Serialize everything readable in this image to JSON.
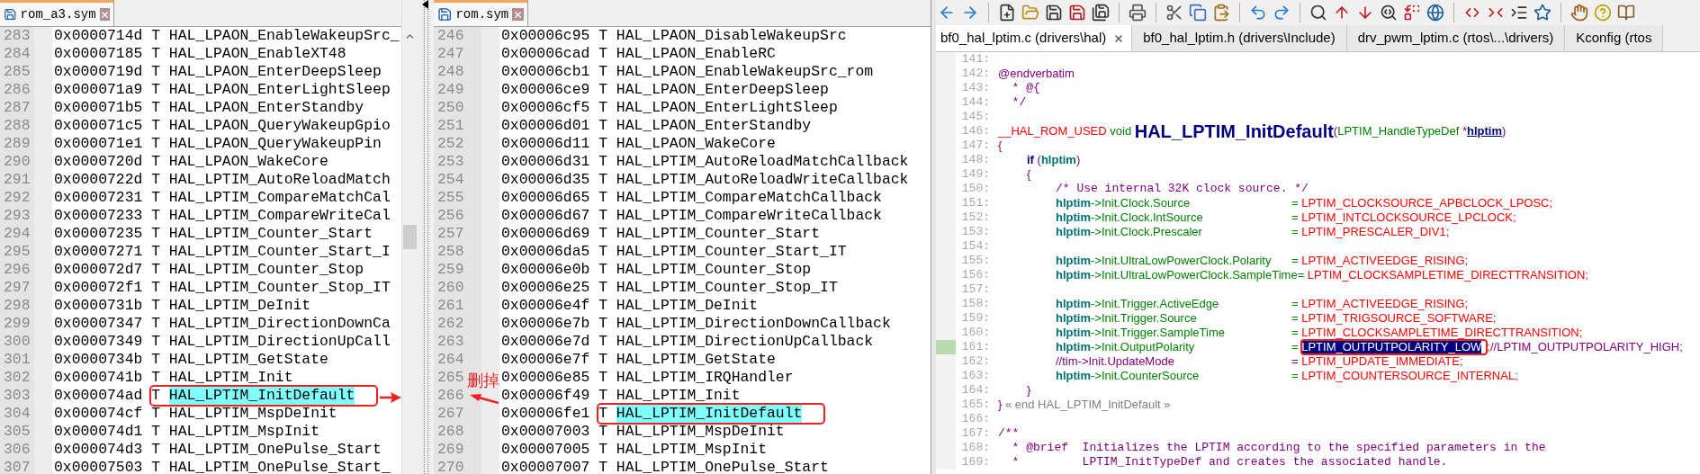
{
  "left_editor": {
    "tab": {
      "label": "rom_a3.sym",
      "selected": true
    },
    "rows": [
      {
        "line": "283",
        "address": "0x0000714d",
        "type": "T",
        "symbol": "HAL_LPAON_EnableWakeupSrc_",
        "highlighted": false
      },
      {
        "line": "284",
        "address": "0x00007185",
        "type": "T",
        "symbol": "HAL_LPAON_EnableXT48",
        "highlighted": false
      },
      {
        "line": "285",
        "address": "0x0000719d",
        "type": "T",
        "symbol": "HAL_LPAON_EnterDeepSleep",
        "highlighted": false
      },
      {
        "line": "286",
        "address": "0x000071a9",
        "type": "T",
        "symbol": "HAL_LPAON_EnterLightSleep",
        "highlighted": false
      },
      {
        "line": "287",
        "address": "0x000071b5",
        "type": "T",
        "symbol": "HAL_LPAON_EnterStandby",
        "highlighted": false
      },
      {
        "line": "288",
        "address": "0x000071c5",
        "type": "T",
        "symbol": "HAL_LPAON_QueryWakeupGpio",
        "highlighted": false
      },
      {
        "line": "289",
        "address": "0x000071e1",
        "type": "T",
        "symbol": "HAL_LPAON_QueryWakeupPin",
        "highlighted": false
      },
      {
        "line": "290",
        "address": "0x0000720d",
        "type": "T",
        "symbol": "HAL_LPAON_WakeCore",
        "highlighted": false
      },
      {
        "line": "291",
        "address": "0x0000722d",
        "type": "T",
        "symbol": "HAL_LPTIM_AutoReloadMatch",
        "highlighted": false
      },
      {
        "line": "292",
        "address": "0x00007231",
        "type": "T",
        "symbol": "HAL_LPTIM_CompareMatchCal",
        "highlighted": false
      },
      {
        "line": "293",
        "address": "0x00007233",
        "type": "T",
        "symbol": "HAL_LPTIM_CompareWriteCal",
        "highlighted": false
      },
      {
        "line": "294",
        "address": "0x00007235",
        "type": "T",
        "symbol": "HAL_LPTIM_Counter_Start",
        "highlighted": false
      },
      {
        "line": "295",
        "address": "0x00007271",
        "type": "T",
        "symbol": "HAL_LPTIM_Counter_Start_I",
        "highlighted": false
      },
      {
        "line": "296",
        "address": "0x000072d7",
        "type": "T",
        "symbol": "HAL_LPTIM_Counter_Stop",
        "highlighted": false
      },
      {
        "line": "297",
        "address": "0x000072f1",
        "type": "T",
        "symbol": "HAL_LPTIM_Counter_Stop_IT",
        "highlighted": false
      },
      {
        "line": "298",
        "address": "0x0000731b",
        "type": "T",
        "symbol": "HAL_LPTIM_DeInit",
        "highlighted": false
      },
      {
        "line": "299",
        "address": "0x00007347",
        "type": "T",
        "symbol": "HAL_LPTIM_DirectionDownCa",
        "highlighted": false
      },
      {
        "line": "300",
        "address": "0x00007349",
        "type": "T",
        "symbol": "HAL_LPTIM_DirectionUpCall",
        "highlighted": false
      },
      {
        "line": "301",
        "address": "0x0000734b",
        "type": "T",
        "symbol": "HAL_LPTIM_GetState",
        "highlighted": false
      },
      {
        "line": "302",
        "address": "0x0000741b",
        "type": "T",
        "symbol": "HAL_LPTIM_Init",
        "highlighted": false
      },
      {
        "line": "303",
        "address": "0x000074ad",
        "type": "T",
        "symbol": "HAL_LPTIM_InitDefault",
        "highlighted": true
      },
      {
        "line": "304",
        "address": "0x000074cf",
        "type": "T",
        "symbol": "HAL_LPTIM_MspDeInit",
        "highlighted": false
      },
      {
        "line": "305",
        "address": "0x000074d1",
        "type": "T",
        "symbol": "HAL_LPTIM_MspInit",
        "highlighted": false
      },
      {
        "line": "306",
        "address": "0x000074d3",
        "type": "T",
        "symbol": "HAL_LPTIM_OnePulse_Start",
        "highlighted": false
      },
      {
        "line": "307",
        "address": "0x00007503",
        "type": "T",
        "symbol": "HAL_LPTIM_OnePulse_Start_",
        "highlighted": false
      }
    ]
  },
  "middle_editor": {
    "tab": {
      "label": "rom.sym",
      "selected": true
    },
    "rows": [
      {
        "line": "246",
        "address": "0x00006c95",
        "type": "T",
        "symbol": "HAL_LPAON_DisableWakeupSrc",
        "highlighted": false
      },
      {
        "line": "247",
        "address": "0x00006cad",
        "type": "T",
        "symbol": "HAL_LPAON_EnableRC",
        "highlighted": false
      },
      {
        "line": "248",
        "address": "0x00006cb1",
        "type": "T",
        "symbol": "HAL_LPAON_EnableWakeupSrc_rom",
        "highlighted": false
      },
      {
        "line": "249",
        "address": "0x00006ce9",
        "type": "T",
        "symbol": "HAL_LPAON_EnterDeepSleep",
        "highlighted": false
      },
      {
        "line": "250",
        "address": "0x00006cf5",
        "type": "T",
        "symbol": "HAL_LPAON_EnterLightSleep",
        "highlighted": false
      },
      {
        "line": "251",
        "address": "0x00006d01",
        "type": "T",
        "symbol": "HAL_LPAON_EnterStandby",
        "highlighted": false
      },
      {
        "line": "252",
        "address": "0x00006d11",
        "type": "T",
        "symbol": "HAL_LPAON_WakeCore",
        "highlighted": false
      },
      {
        "line": "253",
        "address": "0x00006d31",
        "type": "T",
        "symbol": "HAL_LPTIM_AutoReloadMatchCallback",
        "highlighted": false
      },
      {
        "line": "254",
        "address": "0x00006d35",
        "type": "T",
        "symbol": "HAL_LPTIM_AutoReloadWriteCallback",
        "highlighted": false
      },
      {
        "line": "255",
        "address": "0x00006d65",
        "type": "T",
        "symbol": "HAL_LPTIM_CompareMatchCallback",
        "highlighted": false
      },
      {
        "line": "256",
        "address": "0x00006d67",
        "type": "T",
        "symbol": "HAL_LPTIM_CompareWriteCallback",
        "highlighted": false
      },
      {
        "line": "257",
        "address": "0x00006d69",
        "type": "T",
        "symbol": "HAL_LPTIM_Counter_Start",
        "highlighted": false
      },
      {
        "line": "258",
        "address": "0x00006da5",
        "type": "T",
        "symbol": "HAL_LPTIM_Counter_Start_IT",
        "highlighted": false
      },
      {
        "line": "259",
        "address": "0x00006e0b",
        "type": "T",
        "symbol": "HAL_LPTIM_Counter_Stop",
        "highlighted": false
      },
      {
        "line": "260",
        "address": "0x00006e25",
        "type": "T",
        "symbol": "HAL_LPTIM_Counter_Stop_IT",
        "highlighted": false
      },
      {
        "line": "261",
        "address": "0x00006e4f",
        "type": "T",
        "symbol": "HAL_LPTIM_DeInit",
        "highlighted": false
      },
      {
        "line": "262",
        "address": "0x00006e7b",
        "type": "T",
        "symbol": "HAL_LPTIM_DirectionDownCallback",
        "highlighted": false
      },
      {
        "line": "263",
        "address": "0x00006e7d",
        "type": "T",
        "symbol": "HAL_LPTIM_DirectionUpCallback",
        "highlighted": false
      },
      {
        "line": "264",
        "address": "0x00006e7f",
        "type": "T",
        "symbol": "HAL_LPTIM_GetState",
        "highlighted": false
      },
      {
        "line": "265",
        "address": "0x00006e85",
        "type": "T",
        "symbol": "HAL_LPTIM_IRQHandler",
        "highlighted": false
      },
      {
        "line": "266",
        "address": "0x00006f49",
        "type": "T",
        "symbol": "HAL_LPTIM_Init",
        "highlighted": false
      },
      {
        "line": "267",
        "address": "0x00006fe1",
        "type": "T",
        "symbol": "HAL_LPTIM_InitDefault",
        "highlighted": true
      },
      {
        "line": "268",
        "address": "0x00007003",
        "type": "T",
        "symbol": "HAL_LPTIM_MspDeInit",
        "highlighted": false
      },
      {
        "line": "269",
        "address": "0x00007005",
        "type": "T",
        "symbol": "HAL_LPTIM_MspInit",
        "highlighted": false
      },
      {
        "line": "270",
        "address": "0x00007007",
        "type": "T",
        "symbol": "HAL_LPTIM_OnePulse_Start",
        "highlighted": false
      }
    ]
  },
  "annotation": {
    "text": "删掉"
  },
  "right_editor": {
    "tabs": [
      {
        "label": "bf0_hal_lptim.c (drivers\\hal)",
        "selected": true
      },
      {
        "label": "bf0_hal_lptim.h (drivers\\Include)",
        "selected": false
      },
      {
        "label": "drv_pwm_lptim.c (rtos\\...\\drivers)",
        "selected": false
      },
      {
        "label": "Kconfig (rtos",
        "selected": false
      }
    ],
    "lines": [
      {
        "number": "141:",
        "marked": false,
        "kind": "tokens"
      },
      {
        "number": "142:",
        "marked": false,
        "kind": "tokens",
        "tokens": [
          {
            "kind": "doc",
            "text": "@endverbatim"
          }
        ]
      },
      {
        "number": "143:",
        "marked": false,
        "kind": "tokens",
        "tokens": [
          {
            "kind": "comment",
            "text": "  * @{"
          }
        ]
      },
      {
        "number": "144:",
        "marked": false,
        "kind": "tokens",
        "tokens": [
          {
            "kind": "comment",
            "text": "  */"
          }
        ]
      },
      {
        "number": "145:",
        "marked": false,
        "kind": "tokens"
      },
      {
        "number": "146:",
        "marked": false,
        "kind": "tokens",
        "tokens": [
          {
            "kind": "macro",
            "text": "__HAL_ROM_USED"
          },
          {
            "kind": "keyword",
            "text": " void "
          },
          {
            "kind": "function",
            "text": "HAL_LPTIM_InitDefault"
          },
          {
            "kind": "punct",
            "text": "("
          },
          {
            "kind": "type",
            "text": "LPTIM_HandleTypeDef"
          },
          {
            "kind": "punct",
            "text": " *"
          },
          {
            "kind": "param",
            "text": "hlptim"
          },
          {
            "kind": "punct",
            "text": ")"
          }
        ]
      },
      {
        "number": "147:",
        "marked": false,
        "kind": "tokens",
        "tokens": [
          {
            "kind": "punct",
            "text": "{"
          }
        ]
      },
      {
        "number": "148:",
        "marked": false,
        "kind": "tokens",
        "tokens": [
          {
            "kind": "control",
            "text": "\t\tif"
          },
          {
            "kind": "punct",
            "text": " ("
          },
          {
            "kind": "var",
            "text": "hlptim"
          },
          {
            "kind": "punct",
            "text": ")"
          }
        ]
      },
      {
        "number": "149:",
        "marked": false,
        "kind": "tokens",
        "tokens": [
          {
            "kind": "punct",
            "text": "\t\t{"
          }
        ]
      },
      {
        "number": "150:",
        "marked": false,
        "kind": "tokens",
        "tokens": [
          {
            "kind": "comment",
            "text": "\t\t\t\t/* Use internal 32K clock source. */"
          }
        ]
      },
      {
        "number": "151:",
        "marked": false,
        "kind": "assignment",
        "commented": false,
        "target": "hlptim",
        "member": "->Init.Clock.Source",
        "operator": "=",
        "value": "LPTIM_CLOCKSOURCE_APBCLOCK_LPOSC",
        "selected": false,
        "end": ";"
      },
      {
        "number": "152:",
        "marked": false,
        "kind": "assignment",
        "commented": false,
        "target": "hlptim",
        "member": "->Init.Clock.IntSource",
        "operator": "=",
        "value": "LPTIM_INTCLOCKSOURCE_LPCLOCK",
        "selected": false,
        "end": ";"
      },
      {
        "number": "153:",
        "marked": false,
        "kind": "assignment",
        "commented": false,
        "target": "hlptim",
        "member": "->Init.Clock.Prescaler",
        "operator": "=",
        "value": "LPTIM_PRESCALER_DIV1",
        "selected": false,
        "end": ";"
      },
      {
        "number": "154:",
        "marked": false,
        "kind": "tokens"
      },
      {
        "number": "155:",
        "marked": false,
        "kind": "assignment",
        "commented": false,
        "target": "hlptim",
        "member": "->Init.UltraLowPowerClock.Polarity",
        "operator": "=",
        "value": "LPTIM_ACTIVEEDGE_RISING",
        "selected": false,
        "end": ";"
      },
      {
        "number": "156:",
        "marked": false,
        "kind": "assignment",
        "commented": false,
        "target": "hlptim",
        "member": "->Init.UltraLowPowerClock.SampleTime",
        "operator": "=",
        "value": "LPTIM_CLOCKSAMPLETIME_DIRECTTRANSITION",
        "selected": false,
        "end": ";"
      },
      {
        "number": "157:",
        "marked": false,
        "kind": "tokens"
      },
      {
        "number": "158:",
        "marked": false,
        "kind": "assignment",
        "commented": false,
        "target": "hlptim",
        "member": "->Init.Trigger.ActiveEdge",
        "operator": "=",
        "value": "LPTIM_ACTIVEEDGE_RISING",
        "selected": false,
        "end": ";"
      },
      {
        "number": "159:",
        "marked": false,
        "kind": "assignment",
        "commented": false,
        "target": "hlptim",
        "member": "->Init.Trigger.Source",
        "operator": "=",
        "value": "LPTIM_TRIGSOURCE_SOFTWARE",
        "selected": false,
        "end": ";"
      },
      {
        "number": "160:",
        "marked": false,
        "kind": "assignment",
        "commented": false,
        "target": "hlptim",
        "member": "->Init.Trigger.SampleTime",
        "operator": "=",
        "value": "LPTIM_CLOCKSAMPLETIME_DIRECTTRANSITION",
        "selected": false,
        "end": ";"
      },
      {
        "number": "161:",
        "marked": true,
        "kind": "assignment",
        "commented": false,
        "target": "hlptim",
        "member": "->Init.OutputPolarity",
        "operator": "=",
        "value": "LPTIM_OUTPUTPOLARITY_LOW",
        "selected": true,
        "end": ";//LPTIM_OUTPUTPOLARITY_HIGH;"
      },
      {
        "number": "162:",
        "marked": false,
        "kind": "assignment",
        "commented": true,
        "target": "//tim",
        "member": "->Init.UpdateMode",
        "operator": "=",
        "value": "LPTIM_UPDATE_IMMEDIATE",
        "selected": false,
        "end": ";"
      },
      {
        "number": "163:",
        "marked": false,
        "kind": "assignment",
        "commented": false,
        "target": "hlptim",
        "member": "->Init.CounterSource",
        "operator": "=",
        "value": "LPTIM_COUNTERSOURCE_INTERNAL",
        "selected": false,
        "end": ";"
      },
      {
        "number": "164:",
        "marked": false,
        "kind": "tokens",
        "tokens": [
          {
            "kind": "punct",
            "text": "\t\t}"
          }
        ]
      },
      {
        "number": "165:",
        "marked": false,
        "kind": "tokens",
        "tokens": [
          {
            "kind": "punct",
            "text": "}"
          },
          {
            "kind": "fold",
            "text": " « end HAL_LPTIM_InitDefault »"
          }
        ]
      },
      {
        "number": "166:",
        "marked": false,
        "kind": "tokens"
      },
      {
        "number": "167:",
        "marked": false,
        "kind": "tokens",
        "tokens": [
          {
            "kind": "comment",
            "text": "/**"
          }
        ]
      },
      {
        "number": "168:",
        "marked": false,
        "kind": "tokens",
        "tokens": [
          {
            "kind": "comment",
            "text": "  * @brief  Initializes the LPTIM according to the specified parameters in the"
          }
        ]
      },
      {
        "number": "169:",
        "marked": false,
        "kind": "tokens",
        "tokens": [
          {
            "kind": "comment",
            "text": "  *         LPTIM_InitTypeDef and creates the associated handle."
          }
        ]
      }
    ]
  }
}
